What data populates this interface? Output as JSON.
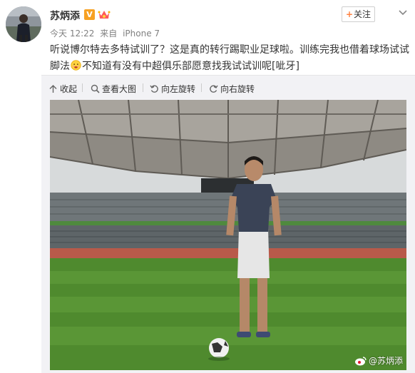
{
  "post": {
    "username": "苏炳添",
    "verified_badge": "V",
    "time": "今天 12:22",
    "source_prefix": "来自",
    "source": "iPhone 7",
    "text_part1": "听说博尔特去多特试训了？这是真的转行踢职业足球啦。训练完我也借着球场试试脚法",
    "text_part2": "不知道有没有中超俱乐部愿意找我试试训呢[呲牙]"
  },
  "follow": {
    "label": "关注"
  },
  "toolbar": {
    "collapse": "收起",
    "view_large": "查看大图",
    "rotate_left": "向左旋转",
    "rotate_right": "向右旋转"
  },
  "photo": {
    "watermark": "@苏炳添"
  },
  "colors": {
    "accent": "#ff8140",
    "badge": "#f7a123",
    "meta_text": "#808080",
    "toolbar_bg": "#f2f2f5"
  },
  "icons": [
    "crown-icon",
    "chevron-down-icon",
    "collapse-icon",
    "search-icon",
    "rotate-left-icon",
    "rotate-right-icon",
    "weibo-icon",
    "face-emoji-icon"
  ]
}
